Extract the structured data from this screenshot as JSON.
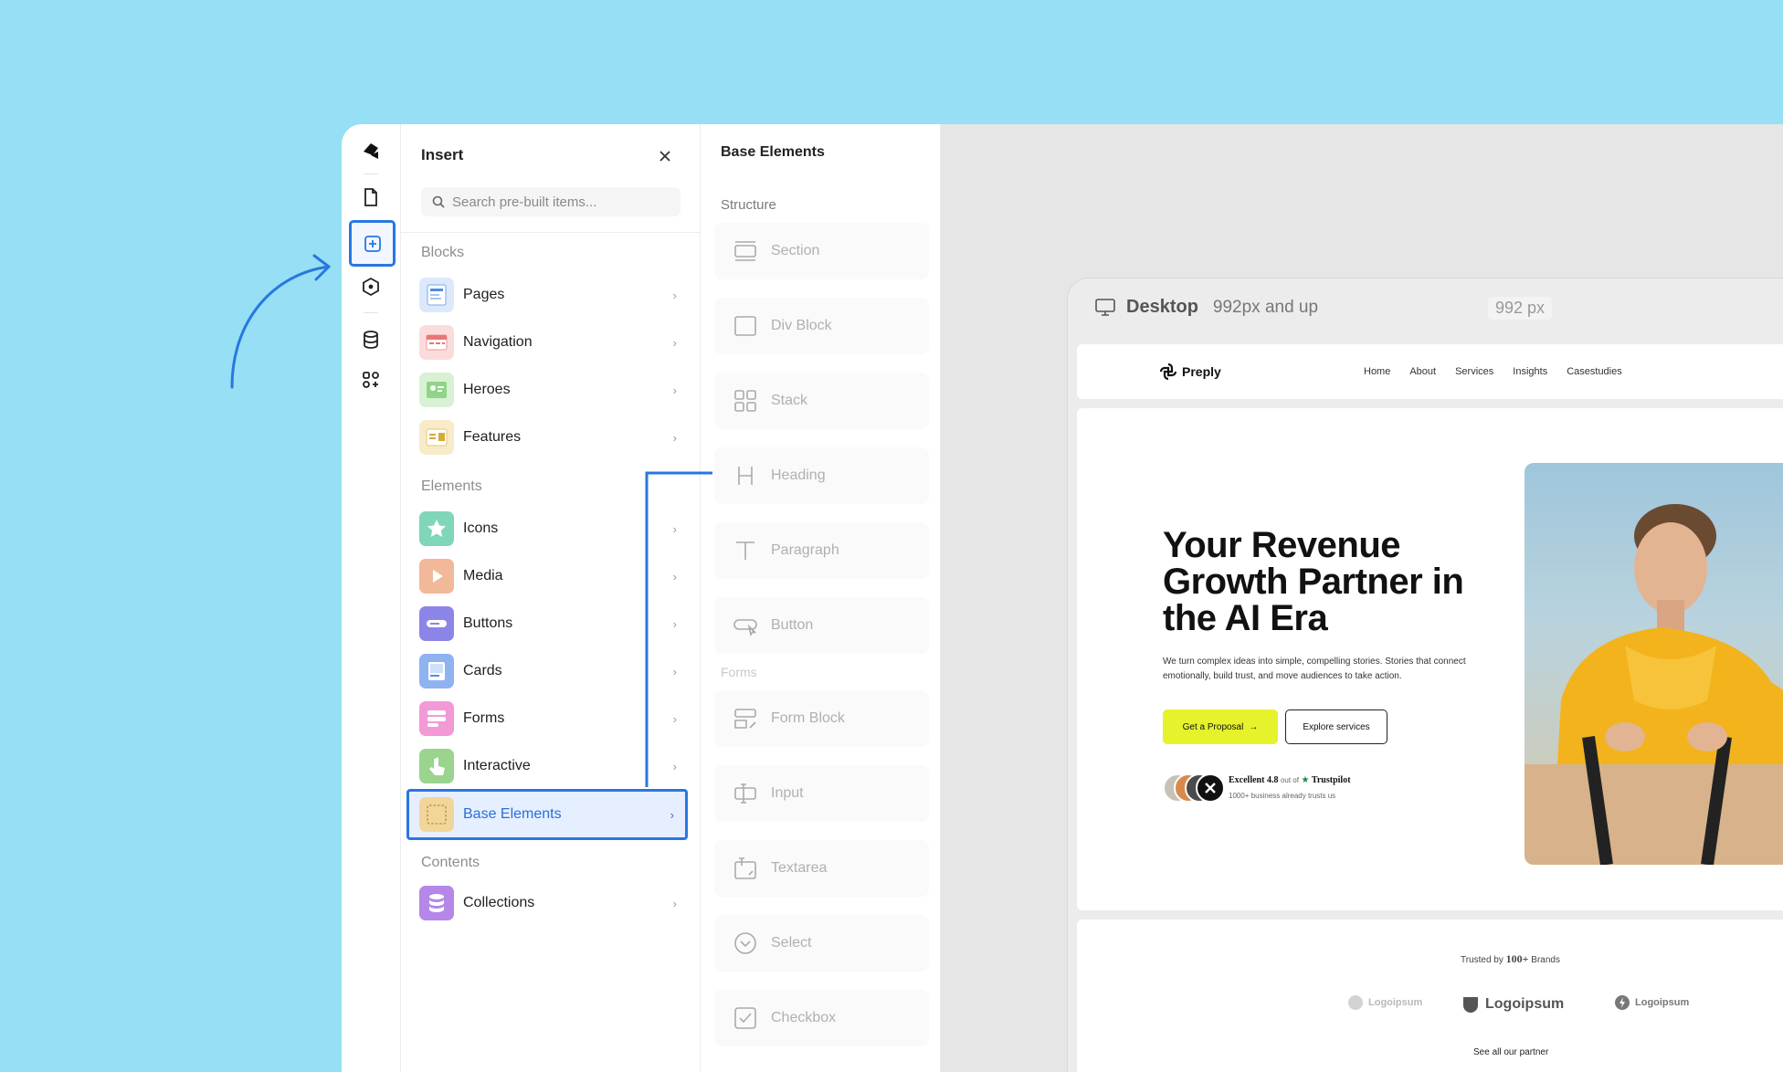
{
  "insert_panel": {
    "title": "Insert",
    "search_placeholder": "Search pre-built items...",
    "sections": {
      "blocks": "Blocks",
      "elements": "Elements",
      "contents": "Contents"
    },
    "blocks": [
      {
        "label": "Pages",
        "icon": "pages-thumb"
      },
      {
        "label": "Navigation",
        "icon": "navigation-thumb"
      },
      {
        "label": "Heroes",
        "icon": "heroes-thumb"
      },
      {
        "label": "Features",
        "icon": "features-thumb"
      }
    ],
    "elements": [
      {
        "label": "Icons",
        "icon": "icons-thumb"
      },
      {
        "label": "Media",
        "icon": "media-thumb"
      },
      {
        "label": "Buttons",
        "icon": "buttons-thumb"
      },
      {
        "label": "Cards",
        "icon": "cards-thumb"
      },
      {
        "label": "Forms",
        "icon": "forms-thumb"
      },
      {
        "label": "Interactive",
        "icon": "interactive-thumb"
      },
      {
        "label": "Base Elements",
        "icon": "base-elements-thumb",
        "selected": true
      }
    ],
    "contents": [
      {
        "label": "Collections",
        "icon": "collections-thumb"
      }
    ]
  },
  "base_panel": {
    "title": "Base Elements",
    "structure_label": "Structure",
    "forms_label": "Forms",
    "structure": [
      "Section",
      "Div Block",
      "Stack",
      "Heading",
      "Paragraph",
      "Button"
    ],
    "forms": [
      "Form Block",
      "Input",
      "Textarea",
      "Select",
      "Checkbox"
    ]
  },
  "canvas": {
    "device": "Desktop",
    "breakpoint": "992px and up",
    "width_readout": "992 px",
    "site": {
      "brand": "Preply",
      "nav_links": [
        "Home",
        "About",
        "Services",
        "Insights",
        "Casestudies"
      ],
      "headline": "Your Revenue Growth Partner in the AI Era",
      "subtext": "We turn complex ideas into simple, compelling stories. Stories that connect emotionally, build trust, and move audiences to take action.",
      "cta_primary": "Get a Proposal",
      "cta_secondary": "Explore services",
      "rating_label": "Excellent",
      "rating_value": "4.8",
      "rating_out_of": "out of",
      "rating_source": "Trustpilot",
      "rating_sub": "1000+ business already trusts us",
      "trusted_prefix": "Trusted by",
      "trusted_count": "100+",
      "trusted_suffix": "Brands",
      "brand_logos": [
        "Logoipsum",
        "Logoipsum",
        "Logoipsum"
      ],
      "see_all": "See all our partner"
    }
  },
  "colors": {
    "background": "#96dff4",
    "accent": "#2877e0",
    "cta_yellow": "#e6f22c"
  }
}
